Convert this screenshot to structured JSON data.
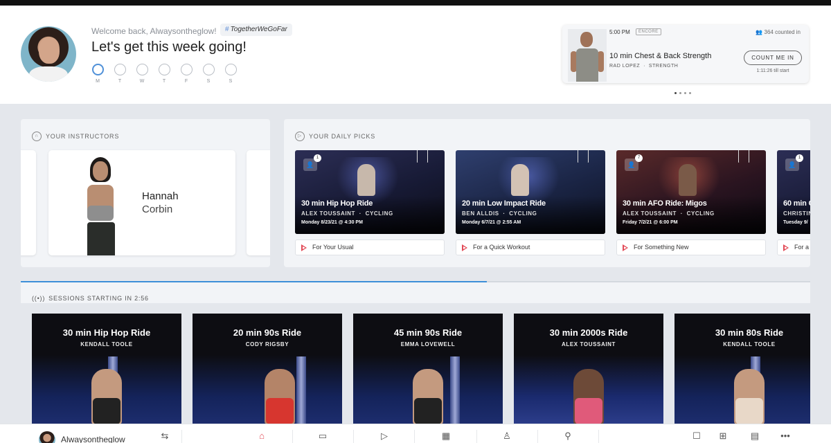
{
  "header": {
    "welcome": "Welcome back, Alwaysontheglow!",
    "hashtag_symbol": "#",
    "hashtag": "TogetherWeGoFar",
    "headline": "Let's get this week going!",
    "week_days": [
      "M",
      "T",
      "W",
      "T",
      "F",
      "S",
      "S"
    ]
  },
  "encore": {
    "time": "5:00 PM",
    "badge": "ENCORE",
    "counted": "364 counted in",
    "title": "10 min Chest & Back Strength",
    "instructor": "RAD LOPEZ",
    "separator": "·",
    "category": "STRENGTH",
    "button": "COUNT ME IN",
    "till_start": "1:11:26 till start"
  },
  "instructors": {
    "title": "YOUR INSTRUCTORS",
    "first_name": "Hannah",
    "last_name": "Corbin"
  },
  "daily_picks": {
    "title": "YOUR DAILY PICKS",
    "items": [
      {
        "title": "30 min Hip Hop Ride",
        "instructor": "ALEX TOUSSAINT",
        "category": "CYCLING",
        "date": "Monday 8/23/21 @ 4:30 PM",
        "friends": "1",
        "reason": "For Your Usual"
      },
      {
        "title": "20 min Low Impact Ride",
        "instructor": "BEN ALLDIS",
        "category": "CYCLING",
        "date": "Monday 6/7/21 @ 2:55 AM",
        "friends": "",
        "reason": "For a Quick Workout"
      },
      {
        "title": "30 min AFO Ride: Migos",
        "instructor": "ALEX TOUSSAINT",
        "category": "CYCLING",
        "date": "Friday 7/2/21 @ 6:00 PM",
        "friends": "7",
        "reason": "For Something New"
      },
      {
        "title": "60 min C",
        "instructor": "CHRISTIN",
        "category": "",
        "date": "Tuesday 9/",
        "friends": "1",
        "reason": "For a"
      }
    ]
  },
  "sessions": {
    "title": "SESSIONS STARTING IN 2:56",
    "progress": 0.59,
    "items": [
      {
        "title": "30 min Hip Hop Ride",
        "instructor": "KENDALL TOOLE"
      },
      {
        "title": "20 min 90s Ride",
        "instructor": "CODY RIGSBY"
      },
      {
        "title": "45 min 90s Ride",
        "instructor": "EMMA LOVEWELL"
      },
      {
        "title": "30 min 2000s Ride",
        "instructor": "ALEX TOUSSAINT"
      },
      {
        "title": "30 min 80s Ride",
        "instructor": "KENDALL TOOLE"
      }
    ]
  },
  "bottom_nav": {
    "username": "Alwaysontheglow",
    "icons": [
      "switch-icon",
      "home-icon",
      "stack-icon",
      "play-icon",
      "calendar-icon",
      "trophy-icon",
      "runner-icon",
      "profile-icon",
      "add-class-icon",
      "grid-icon",
      "more-icon"
    ]
  },
  "colors": {
    "accent_blue": "#3d8fd8",
    "brand_red": "#e24b57"
  }
}
